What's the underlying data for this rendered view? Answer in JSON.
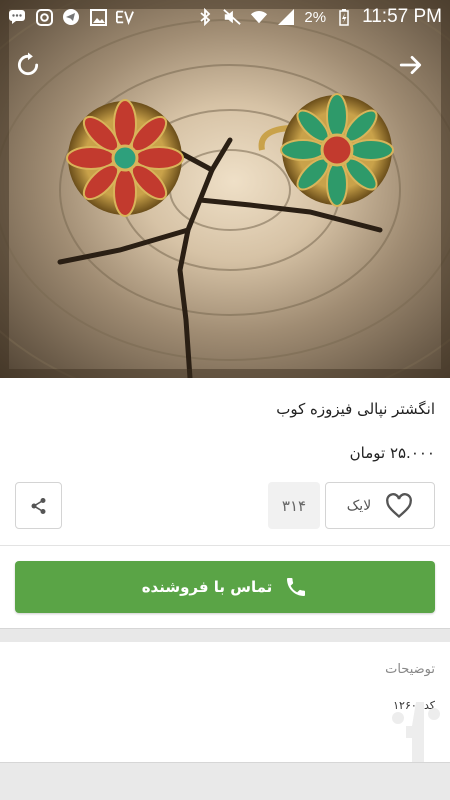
{
  "status_bar": {
    "battery_percent": "2%",
    "time": "11:57 PM",
    "icons_left": [
      "chat-bubble-icon",
      "instagram-icon",
      "telegram-icon",
      "gallery-icon",
      "app-icon"
    ],
    "icons_right": [
      "bluetooth-icon",
      "mute-icon",
      "wifi-icon",
      "signal-icon",
      "battery-icon"
    ]
  },
  "header": {
    "refresh_icon": "refresh-icon",
    "forward_icon": "arrow-right-icon"
  },
  "product": {
    "title": "انگشتر نپالی فیزوزه کوب",
    "price": "۲۵.۰۰۰ تومان"
  },
  "actions": {
    "share_icon": "share-icon",
    "like_count": "۳۱۴",
    "like_label": "لایک",
    "like_icon": "heart-icon"
  },
  "contact": {
    "label": "تماس با فروشنده",
    "icon": "phone-icon",
    "color": "#5aa446"
  },
  "description": {
    "title": "توضیحات",
    "code": "کد: ۱۲۶۰"
  }
}
